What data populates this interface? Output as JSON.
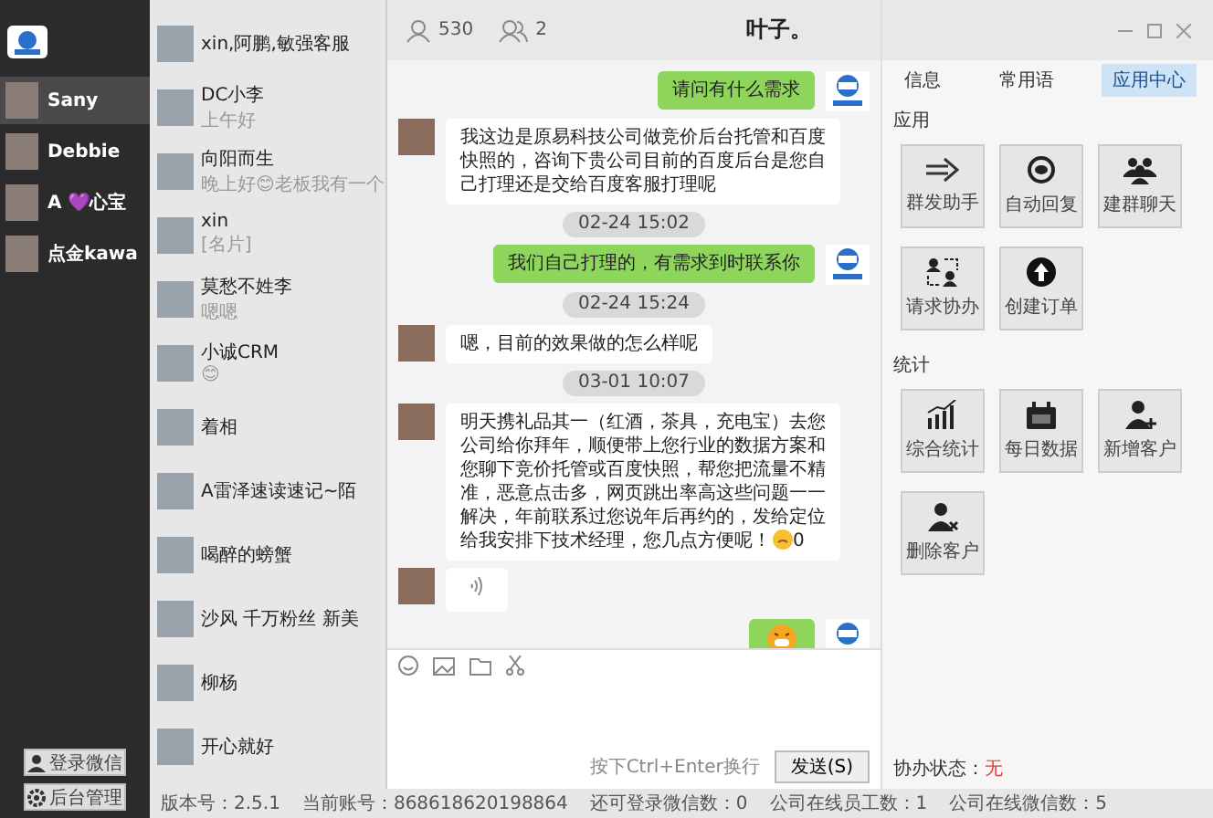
{
  "accounts": [
    {
      "name": "Sany",
      "selected": true
    },
    {
      "name": "Debbie",
      "selected": false
    },
    {
      "name": "A 💜心宝",
      "selected": false
    },
    {
      "name": "点金kawa",
      "selected": false
    }
  ],
  "side_buttons": [
    {
      "label": "登录微信",
      "kind": "user"
    },
    {
      "label": "后台管理",
      "kind": "gear"
    }
  ],
  "contacts": [
    {
      "name": "xin,阿鹏,敏强客服"
    },
    {
      "name": "DC小李",
      "preview": "上午好"
    },
    {
      "name": "向阳而生",
      "preview": "晚上好😊老板我有一个"
    },
    {
      "name": "xin",
      "preview": "[名片]"
    },
    {
      "name": "莫愁不姓李",
      "preview": "嗯嗯"
    },
    {
      "name": "小诚CRM",
      "preview": "😊"
    },
    {
      "name": "着相"
    },
    {
      "name": "A雷泽速读速记~陌"
    },
    {
      "name": "喝醉的螃蟹"
    },
    {
      "name": "沙风 千万粉丝 新美"
    },
    {
      "name": "柳杨"
    },
    {
      "name": "开心就好"
    }
  ],
  "header": {
    "friends": "530",
    "groups": "2",
    "title": "叶子。"
  },
  "messages": [
    {
      "kind": "text",
      "outgoing": true,
      "text": "请问有什么需求"
    },
    {
      "kind": "text",
      "outgoing": false,
      "text": "我这边是原易科技公司做竞价后台托管和百度快照的，咨询下贵公司目前的百度后台是您自己打理还是交给百度客服打理呢"
    },
    {
      "kind": "time",
      "text": "02-24 15:02"
    },
    {
      "kind": "text",
      "outgoing": true,
      "text": "我们自己打理的，有需求到时联系你"
    },
    {
      "kind": "time",
      "text": "02-24 15:24"
    },
    {
      "kind": "text",
      "outgoing": false,
      "text": "嗯，目前的效果做的怎么样呢"
    },
    {
      "kind": "time",
      "text": "03-01 10:07"
    },
    {
      "kind": "text",
      "outgoing": false,
      "text": "明天携礼品其一（红酒，茶具，充电宝）去您公司给你拜年，顺便带上您行业的数据方案和您聊下竞价托管或百度快照，帮您把流量不精准，恶意点击多，网页跳出率高这些问题一一解决，年前联系过您说年后再约的，发给定位给我安排下技术经理，您几点方便呢！",
      "emoji": true,
      "suffix": "0"
    },
    {
      "kind": "voice",
      "outgoing": false
    },
    {
      "kind": "emoji",
      "outgoing": true
    }
  ],
  "input": {
    "hint": "按下Ctrl+Enter换行",
    "send": "发送(S)"
  },
  "tabs": [
    {
      "label": "信息",
      "selected": false
    },
    {
      "label": "常用语",
      "selected": false
    },
    {
      "label": "应用中心",
      "selected": true
    }
  ],
  "sections": [
    {
      "title": "应用",
      "tools": [
        {
          "label": "群发助手",
          "kind": "arrow"
        },
        {
          "label": "自动回复",
          "kind": "reply"
        },
        {
          "label": "建群聊天",
          "kind": "group"
        },
        {
          "label": "请求协办",
          "kind": "assist"
        },
        {
          "label": "创建订单",
          "kind": "upload"
        }
      ]
    },
    {
      "title": "统计",
      "tools": [
        {
          "label": "综合统计",
          "kind": "chart"
        },
        {
          "label": "每日数据",
          "kind": "calendar"
        },
        {
          "label": "新增客户",
          "kind": "adduser"
        },
        {
          "label": "删除客户",
          "kind": "deluser"
        }
      ]
    }
  ],
  "assist_status": {
    "label": "协办状态：",
    "value": "无"
  },
  "status_bar": [
    "版本号：2.5.1",
    "当前账号：868618620198864",
    "还可登录微信数：0",
    "公司在线员工数：1",
    "公司在线微信数：5"
  ]
}
